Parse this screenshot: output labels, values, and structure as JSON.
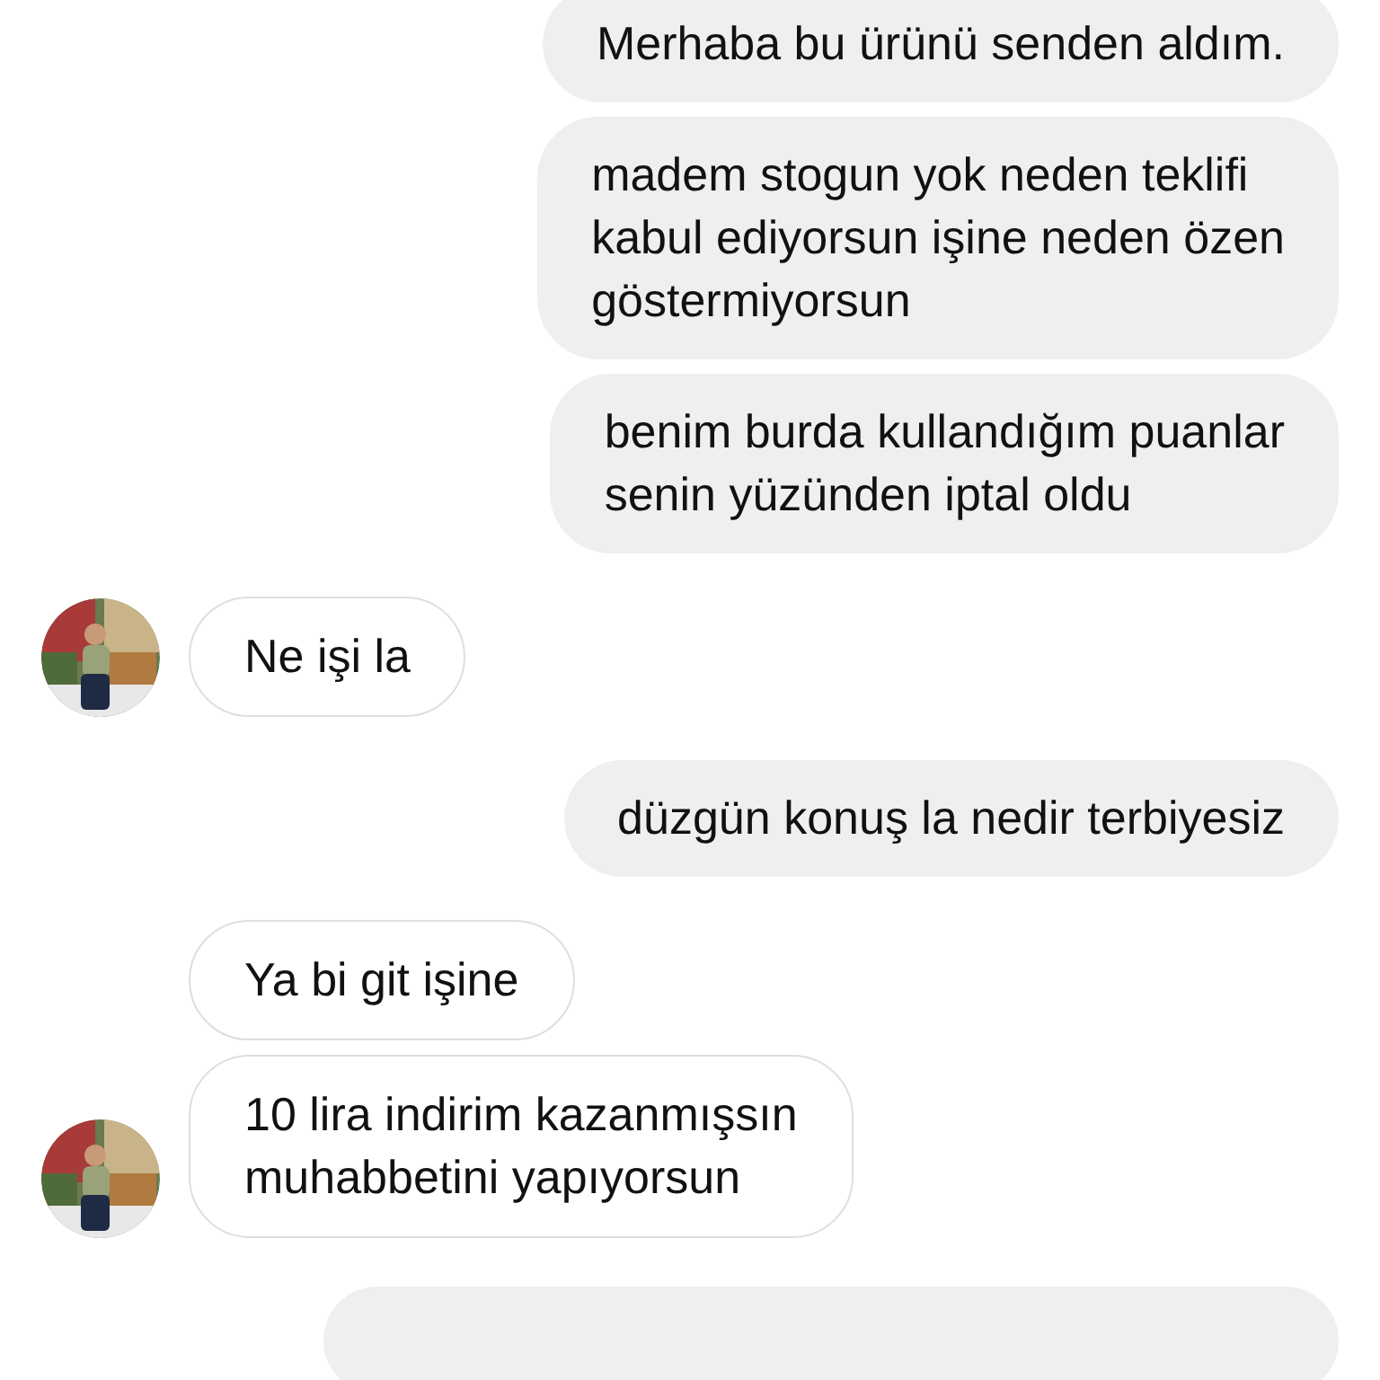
{
  "messages": [
    {
      "kind": "sent",
      "text": "Merhaba bu ürünü senden aldım."
    },
    {
      "kind": "sent",
      "text": "madem stogun yok neden teklifi\nkabul ediyorsun işine neden özen\ngöstermiyorsun"
    },
    {
      "kind": "sent",
      "text": "benim burda kullandığım puanlar\nsenin yüzünden iptal oldu"
    },
    {
      "kind": "received",
      "text": "Ne işi la"
    },
    {
      "kind": "sent",
      "text": "düzgün konuş la nedir terbiyesiz"
    },
    {
      "kind": "received",
      "text": "Ya bi git işine"
    },
    {
      "kind": "received",
      "text": "10 lira indirim kazanmışsın\nmuhabbetini yapıyorsun"
    }
  ]
}
